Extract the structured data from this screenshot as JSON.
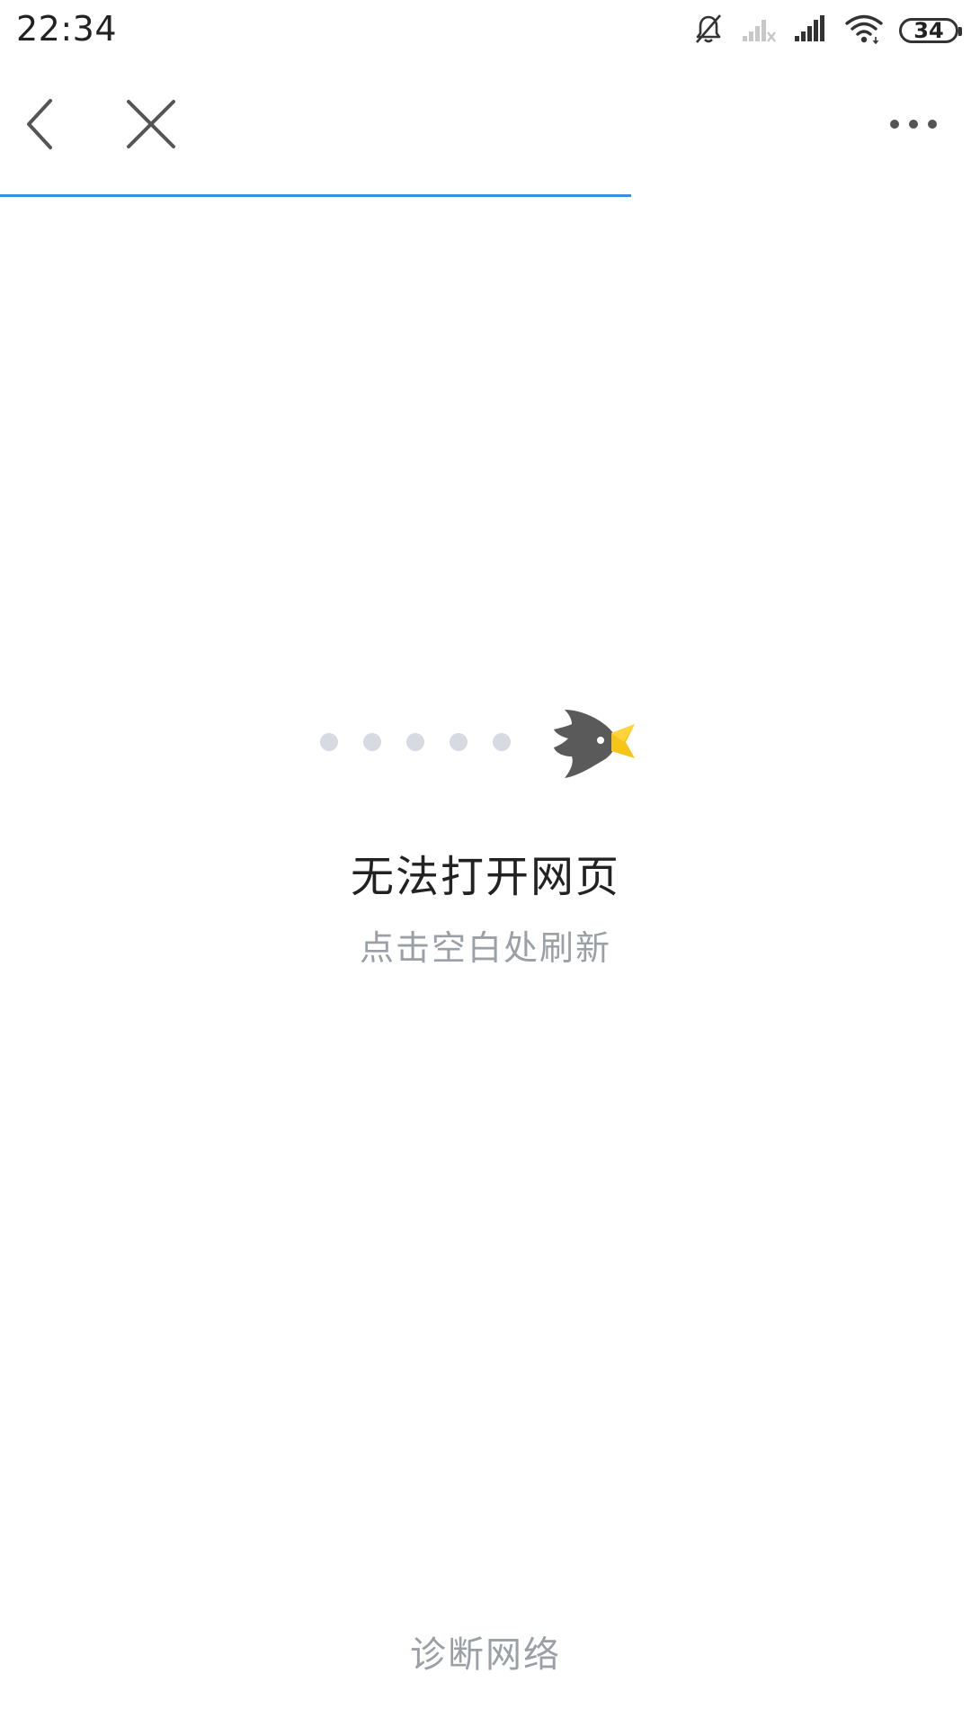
{
  "status_bar": {
    "time": "22:34",
    "battery": "34",
    "icons": [
      "notifications-muted-icon",
      "signal-sim2-no-service-icon",
      "signal-sim1-icon",
      "wifi-icon",
      "battery-icon"
    ]
  },
  "navbar": {
    "back_icon": "chevron-left-icon",
    "close_icon": "close-icon",
    "more_icon": "more-horizontal-icon",
    "progress_fraction": 0.65,
    "progress_color": "#3b8fdc"
  },
  "error": {
    "illustration_icon": "bird-loading-icon",
    "title": "无法打开网页",
    "subtitle": "点击空白处刷新",
    "diagnose_label": "诊断网络"
  }
}
